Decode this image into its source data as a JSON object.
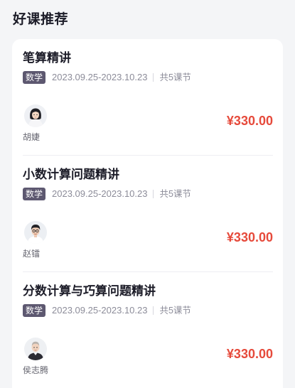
{
  "page": {
    "title": "好课推荐"
  },
  "courses": [
    {
      "title": "笔算精讲",
      "subject": "数学",
      "date_range": "2023.09.25-2023.10.23",
      "lessons": "共5课节",
      "teacher": "胡婕",
      "price": "¥330.00"
    },
    {
      "title": "小数计算问题精讲",
      "subject": "数学",
      "date_range": "2023.09.25-2023.10.23",
      "lessons": "共5课节",
      "teacher": "赵镭",
      "price": "¥330.00"
    },
    {
      "title": "分数计算与巧算问题精讲",
      "subject": "数学",
      "date_range": "2023.09.25-2023.10.23",
      "lessons": "共5课节",
      "teacher": "侯志腾",
      "price": "¥330.00"
    }
  ],
  "colors": {
    "background": "#f4f5f7",
    "card": "#ffffff",
    "price": "#e64a3b",
    "subject_tag": "#5d5870",
    "muted_text": "#8c8c99"
  },
  "icons": [
    "teacher-avatar"
  ]
}
